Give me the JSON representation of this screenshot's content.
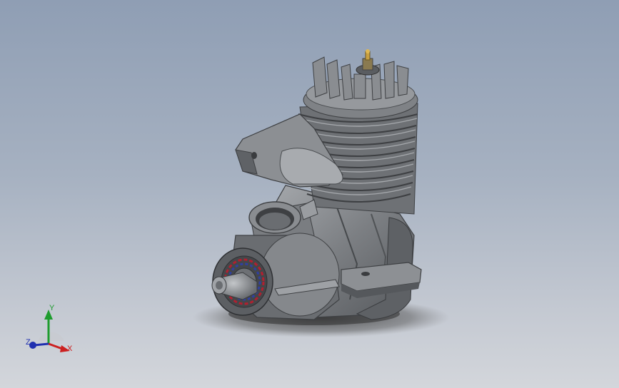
{
  "viewport": {
    "model": "engine-assembly",
    "colors": {
      "background_top": "#8f9eb4",
      "background_bottom": "#d3d6db",
      "part_gray": "#7c7f83",
      "part_dark": "#4b4d50",
      "part_light": "#b4b7ba",
      "plug_gold": "#c8a040",
      "bearing_red": "#b02030",
      "bearing_blue": "#3040a0"
    }
  },
  "triad": {
    "x_label": "X",
    "y_label": "Y",
    "z_label": "Z",
    "colors": {
      "x": "#cc2020",
      "y": "#1e9c2e",
      "z": "#2030b0"
    }
  }
}
